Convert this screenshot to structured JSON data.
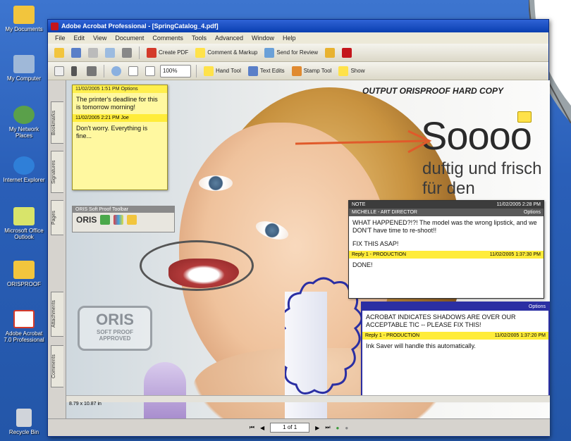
{
  "desktop": {
    "icons": [
      {
        "label": "My Documents",
        "color": "#f2c53d"
      },
      {
        "label": "My Computer",
        "color": "#9fb8d8"
      },
      {
        "label": "My Network Places",
        "color": "#5aa04a"
      },
      {
        "label": "Internet Explorer",
        "color": "#2f7fd8"
      },
      {
        "label": "Microsoft Office Outlook",
        "color": "#d8e46a"
      },
      {
        "label": "ORISPROOF",
        "color": "#f2c53d"
      },
      {
        "label": "Adobe Acrobat 7.0 Professional",
        "color": "#d43a2a"
      },
      {
        "label": "Recycle Bin",
        "color": "#d0d4da"
      }
    ]
  },
  "window": {
    "title": "Adobe Acrobat Professional - [SpringCatalog_4.pdf]",
    "menu": [
      "File",
      "Edit",
      "View",
      "Document",
      "Comments",
      "Tools",
      "Advanced",
      "Window",
      "Help"
    ],
    "toolbar1": [
      "Create PDF",
      "Comment & Markup",
      "Send for Review"
    ],
    "toolbar2": {
      "zoom": "100%",
      "items": [
        "Hand Tool",
        "Text Edits",
        "Stamp Tool",
        "Show"
      ]
    },
    "nav_tabs": [
      "Bookmarks",
      "Signatures",
      "Pages",
      "Attachments",
      "Comments"
    ]
  },
  "document": {
    "output_label": "OUTPUT ORISPROOF HARD COPY",
    "headline": "Soooo",
    "subhead1": "duftig und frisch",
    "subhead2": "für den"
  },
  "comment1": {
    "header": "11/02/2005 1:51 PM Options",
    "text": "The printer's deadline for this is tomorrow morning!",
    "reply_header": "11/02/2005 2:21 PM Joe",
    "reply_text": "Don't worry. Everything is fine..."
  },
  "oris_toolbar": {
    "title": "ORIS Soft Proof Toolbar",
    "brand": "ORIS"
  },
  "stamp": {
    "line1": "ORIS",
    "line2": "SOFT PROOF",
    "line3": "APPROVED"
  },
  "comment2": {
    "header_left": "NOTE",
    "author": "MICHELLE - ART DIRECTOR",
    "date": "11/02/2005 2:28 PM",
    "options": "Options",
    "text": "WHAT HAPPENED?!?! The model was the wrong lipstick, and we DON'T have time to re-shoot!!",
    "text2": "FIX THIS ASAP!",
    "reply_label": "Reply 1 - PRODUCTION",
    "reply_date": "11/02/2005 1:37:30 PM",
    "reply_text": "DONE!"
  },
  "comment3": {
    "options": "Options",
    "text": "ACROBAT INDICATES SHADOWS ARE OVER OUR ACCEPTABLE TIC -- PLEASE FIX THIS!",
    "reply_label": "Reply 1 - PRODUCTION",
    "reply_date": "11/02/2005 1:37:20 PM",
    "reply_text": "Ink Saver will handle this automatically."
  },
  "scrollbar": {
    "label": "8.79 x 10.87 in"
  },
  "status": {
    "page": "1 of 1"
  }
}
